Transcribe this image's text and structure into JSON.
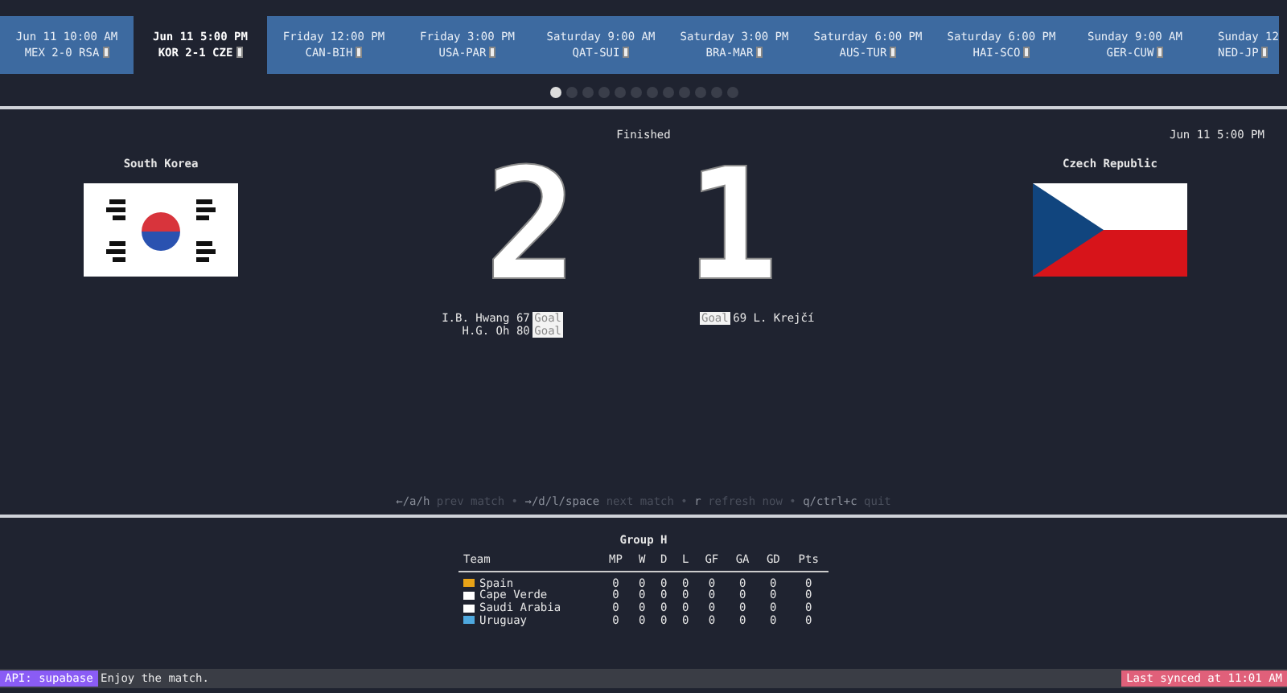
{
  "matches": [
    {
      "when": "Jun 11 10:00 AM",
      "line": "MEX 2-0 RSA",
      "selected": false
    },
    {
      "when": "Jun 11 5:00 PM",
      "line": "KOR 2-1 CZE",
      "selected": true
    },
    {
      "when": "Friday 12:00 PM",
      "line": "CAN-BIH",
      "selected": false
    },
    {
      "when": "Friday 3:00 PM",
      "line": "USA-PAR",
      "selected": false
    },
    {
      "when": "Saturday 9:00 AM",
      "line": "QAT-SUI",
      "selected": false
    },
    {
      "when": "Saturday 3:00 PM",
      "line": "BRA-MAR",
      "selected": false
    },
    {
      "when": "Saturday 6:00 PM",
      "line": "AUS-TUR",
      "selected": false
    },
    {
      "when": "Saturday 6:00 PM",
      "line": "HAI-SCO",
      "selected": false
    },
    {
      "when": "Sunday 9:00 AM",
      "line": "GER-CUW",
      "selected": false
    },
    {
      "when": "Sunday 12",
      "line": "NED-JP",
      "selected": false
    }
  ],
  "pages": [
    {
      "selected": true
    },
    {
      "selected": false
    },
    {
      "selected": false
    },
    {
      "selected": false
    },
    {
      "selected": false
    },
    {
      "selected": false
    },
    {
      "selected": false
    },
    {
      "selected": false
    },
    {
      "selected": false
    },
    {
      "selected": false
    },
    {
      "selected": false
    },
    {
      "selected": false
    }
  ],
  "match": {
    "status": "Finished",
    "kickoff": "Jun 11 5:00 PM",
    "home": {
      "name": "South Korea",
      "flag": {
        "kind": "kor"
      },
      "score": "2",
      "goals": [
        {
          "player": "I.B. Hwang 67",
          "tag": "Goal"
        },
        {
          "player": "H.G. Oh 80",
          "tag": "Goal"
        }
      ]
    },
    "away": {
      "name": "Czech Republic",
      "flag": {
        "kind": "cze"
      },
      "score": "1",
      "goals": [
        {
          "player": "69 L. Krejčí",
          "tag": "Goal"
        }
      ]
    }
  },
  "hints": {
    "separator": "•",
    "items": [
      {
        "key": "←/a/h",
        "action": "prev match"
      },
      {
        "key": "→/d/l/space",
        "action": "next match"
      },
      {
        "key": "r",
        "action": "refresh now"
      },
      {
        "key": "q/ctrl+c",
        "action": "quit"
      }
    ]
  },
  "standings": {
    "title": "Group H",
    "columns": [
      "Team",
      "MP",
      "W",
      "D",
      "L",
      "GF",
      "GA",
      "GD",
      "Pts"
    ],
    "rows": [
      {
        "color": "#e8a317",
        "cells": [
          "Spain",
          "0",
          "0",
          "0",
          "0",
          "0",
          "0",
          "0",
          "0"
        ]
      },
      {
        "color": "#ffffff",
        "cells": [
          "Cape Verde",
          "0",
          "0",
          "0",
          "0",
          "0",
          "0",
          "0",
          "0"
        ]
      },
      {
        "color": "#ffffff",
        "cells": [
          "Saudi Arabia",
          "0",
          "0",
          "0",
          "0",
          "0",
          "0",
          "0",
          "0"
        ]
      },
      {
        "color": "#4ea8de",
        "cells": [
          "Uruguay",
          "0",
          "0",
          "0",
          "0",
          "0",
          "0",
          "0",
          "0"
        ]
      }
    ]
  },
  "status_bar": {
    "api": "API: supabase",
    "message": "Enjoy the match.",
    "synced": "Last synced at 11:01 AM"
  }
}
